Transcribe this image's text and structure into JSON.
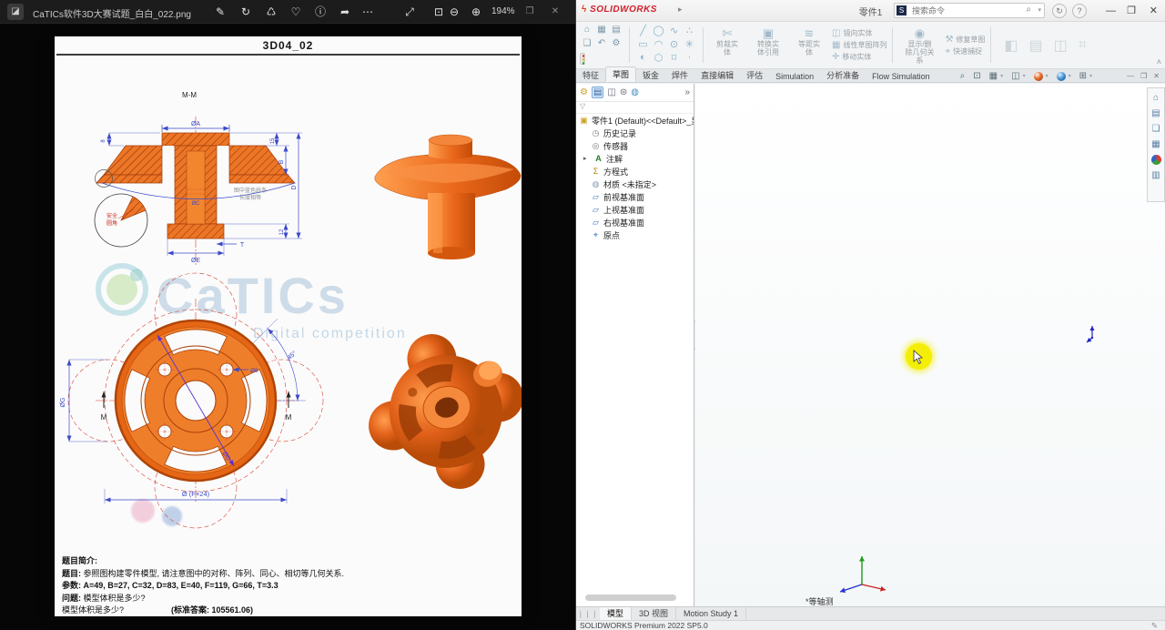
{
  "photos": {
    "filename": "CaTICs软件3D大赛试题_白白_022.png",
    "zoom_level": "194%",
    "icons": {
      "app": "◪",
      "edit": "✎",
      "rotate": "↻",
      "delete": "♺",
      "favorite": "♡",
      "info": "ⓘ",
      "share": "➦",
      "more": "⋯",
      "fullscreen": "⤢",
      "fit": "⊡",
      "zoom_out": "⊖",
      "zoom_in": "⊕",
      "restore": "❐",
      "close": "✕"
    }
  },
  "drawing": {
    "title": "3D04_02",
    "section_label": "M-M",
    "watermark": {
      "brand": "CaTICs",
      "subtitle": "Digital competition"
    },
    "notes": {
      "blue1": "图中蓝色线条",
      "blue2": "长度相等",
      "detail1": "安全",
      "detail2": "圆角"
    },
    "dims": {
      "dia_a": "ØA",
      "lip8": "8",
      "h15": "15",
      "dim_b": "B",
      "dim_d": "D",
      "h12": "12",
      "dim_t": "T",
      "dia_e": "ØE",
      "dia_c": "ØC",
      "dia_g": "ØG",
      "dia_f": "Ø (F+24)",
      "hole": "Ø8",
      "angle": "45°",
      "diag": "ØD",
      "sec_m_left": "M",
      "sec_m_right": "M"
    },
    "footer": {
      "intro": "题目简介:",
      "q_label": "题目:",
      "q_text": "参照图构建零件模型, 请注意图中的对称、阵列、同心、相切等几何关系.",
      "p_label": "参数:",
      "p_text": "A=49,  B=27,  C=32,  D=83,  E=40,  F=119,  G=66,  T=3.3",
      "w_label": "问题:",
      "w_text": "模型体积是多少?",
      "v_text": "模型体积是多少?",
      "answer": "(标准答案: 105561.06)"
    }
  },
  "solidworks": {
    "titlebar": {
      "brand": "SOLIDWORKS",
      "brand_bolt": "ϟ",
      "menu_arrow": "▸",
      "doc_title": "零件1",
      "search_text": "搜索命令",
      "icons": {
        "badge": "S",
        "search": "⌕",
        "dropdown": "▾",
        "help": "?",
        "account": "↻",
        "minimize": "—",
        "restore": "❐",
        "close": "✕"
      }
    },
    "ribbon": {
      "mini_icons": [
        "⌂",
        "▦",
        "▤",
        "❏",
        "↶",
        "⚙"
      ],
      "shape_icons": [
        "╱",
        "◯",
        "∿",
        "∴",
        "▭",
        "◠",
        "⊙",
        "✳",
        "◐",
        "⬡",
        "⌑",
        "·"
      ],
      "btn_trim": "剪裁实体",
      "btn_trim_icon": "✄",
      "btn_convert": "转换实体引用",
      "btn_convert_icon": "▣",
      "btn_offset": "等距实体",
      "btn_offset_icon": "≋",
      "stack1": [
        "镜向实体",
        "线性草图阵列",
        "移动实体"
      ],
      "stack1_icons": [
        "◫",
        "▦",
        "✛"
      ],
      "btn_relations": "显示/删除几何关系",
      "btn_relations_icon": "◉",
      "stack2": [
        "修复草图",
        "快速捕捉"
      ],
      "stack2_icons": [
        "⚒",
        "⌖"
      ],
      "ghost_icons": [
        "◧",
        "▤",
        "◫",
        "⌗"
      ],
      "collapse": "˄"
    },
    "headsup": {
      "icons": [
        "⌕",
        "⊡",
        "▦",
        "◫"
      ],
      "grid": "⊞",
      "win_min": "—",
      "win_restore": "❐",
      "win_close": "✕"
    },
    "tabs": [
      "特征",
      "草图",
      "钣金",
      "焊件",
      "直接编辑",
      "评估",
      "Simulation",
      "分析准备",
      "Flow Simulation"
    ],
    "tree": {
      "header_more": "»",
      "filter": "▽",
      "expand_arrow": "▸",
      "root": "零件1 (Default)<<Default>_显",
      "root_icon": "▣",
      "items": [
        "历史记录",
        "传感器",
        "注解",
        "方程式",
        "材质 <未指定>",
        "前视基准面",
        "上视基准面",
        "右视基准面",
        "原点"
      ],
      "icons": [
        "◷",
        "◎",
        "A",
        "Σ",
        "◍",
        "▱",
        "▱",
        "▱",
        "⌖"
      ]
    },
    "taskpane_icons": [
      "⌂",
      "▤",
      "❏",
      "▦"
    ],
    "taskpane_list_icon": "▥",
    "viewport": {
      "view_label": "*等轴测"
    },
    "doc_tabs": [
      "模型",
      "3D 视图",
      "Motion Study 1"
    ],
    "doc_tabs_corner": "❘❘❘",
    "status": "SOLIDWORKS Premium 2022 SP5.0",
    "status_icon": "✎"
  }
}
